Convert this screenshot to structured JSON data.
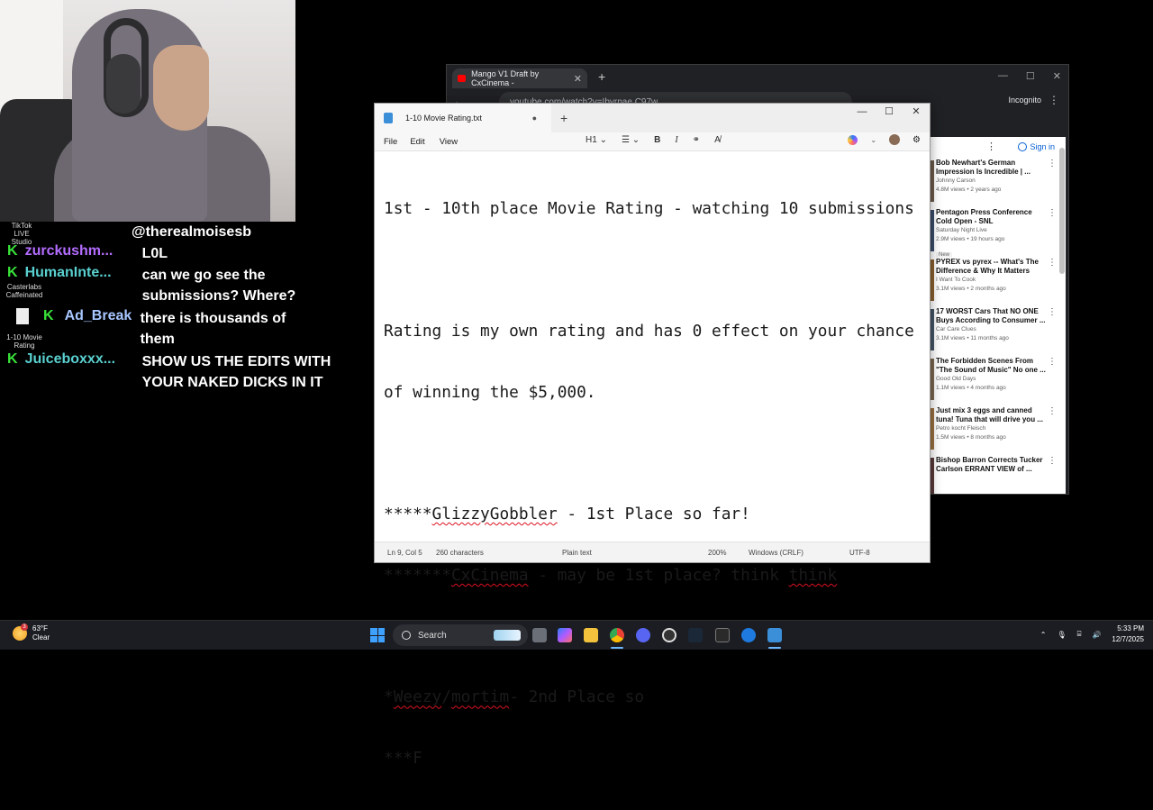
{
  "chat": {
    "tiktok_label": "TikTok LIVE Studio",
    "casterlabs_label": "Casterlabs Caffeinated",
    "rating_file_label": "1-10 Movie Rating",
    "messages": [
      {
        "name": "",
        "text": "@therealmoisesb",
        "name_color": "#ffffff"
      },
      {
        "name": "zurckushm...",
        "text": "L0L",
        "name_color": "#b46cff"
      },
      {
        "name": "HumanInte...",
        "text": "can we go see the submissions? Where?",
        "name_color": "#5ad0d0"
      },
      {
        "name": "Ad_Break",
        "text": "there is thousands of them",
        "name_color": "#a8c7ff"
      },
      {
        "name": "Juiceboxxx...",
        "text": "SHOW US THE EDITS WITH YOUR NAKED DICKS IN IT",
        "name_color": "#5ad0d0"
      }
    ]
  },
  "chrome": {
    "tab_title": "Mango V1 Draft by CxCinema -",
    "url": "youtube.com/watch?v=Ibyrpae C97w",
    "incognito_label": "Incognito",
    "signin_label": "Sign in",
    "videos": [
      {
        "title": "Bob Newhart's German Impression Is Incredible | ...",
        "channel": "Johnny Carson",
        "meta": "4.8M views • 2 years ago",
        "thumb": "#6b5a4a"
      },
      {
        "title": "Pentagon Press Conference Cold Open - SNL",
        "channel": "Saturday Night Live",
        "meta": "2.9M views • 19 hours ago",
        "badge": "New",
        "thumb": "#3a4a6a"
      },
      {
        "title": "PYREX vs pyrex -- What's The Difference & Why It Matters",
        "channel": "I Want To Cook",
        "meta": "3.1M views • 2 months ago",
        "thumb": "#8a6030"
      },
      {
        "title": "17 WORST Cars That NO ONE Buys According to Consumer ...",
        "channel": "Car Care Clues",
        "meta": "3.1M views • 11 months ago",
        "thumb": "#445566"
      },
      {
        "title": "The Forbidden Scenes From \"The Sound of Music\" No one ...",
        "channel": "Good Old Days",
        "meta": "1.1M views • 4 months ago",
        "thumb": "#7a6650"
      },
      {
        "title": "Just mix 3 eggs and canned tuna! Tuna that will drive you ...",
        "channel": "Petro kocht Fleisch",
        "meta": "1.5M views • 8 months ago",
        "thumb": "#9a7040"
      },
      {
        "title": "Bishop Barron Corrects Tucker Carlson ERRANT VIEW of ...",
        "channel": "",
        "meta": "",
        "thumb": "#5a3a3a"
      }
    ]
  },
  "notepad": {
    "tab_title": "1-10 Movie Rating.txt",
    "menu": [
      "File",
      "Edit",
      "View"
    ],
    "heading_tool": "H1",
    "status": {
      "position": "Ln 9, Col 5",
      "chars": "260 characters",
      "format": "Plain text",
      "zoom": "200%",
      "line_ending": "Windows (CRLF)",
      "encoding": "UTF-8"
    }
  },
  "taskbar": {
    "temp": "63°F",
    "condition": "Clear",
    "weather_badge": "3",
    "search_placeholder": "Search",
    "time": "5:33 PM",
    "date": "12/7/2025"
  }
}
